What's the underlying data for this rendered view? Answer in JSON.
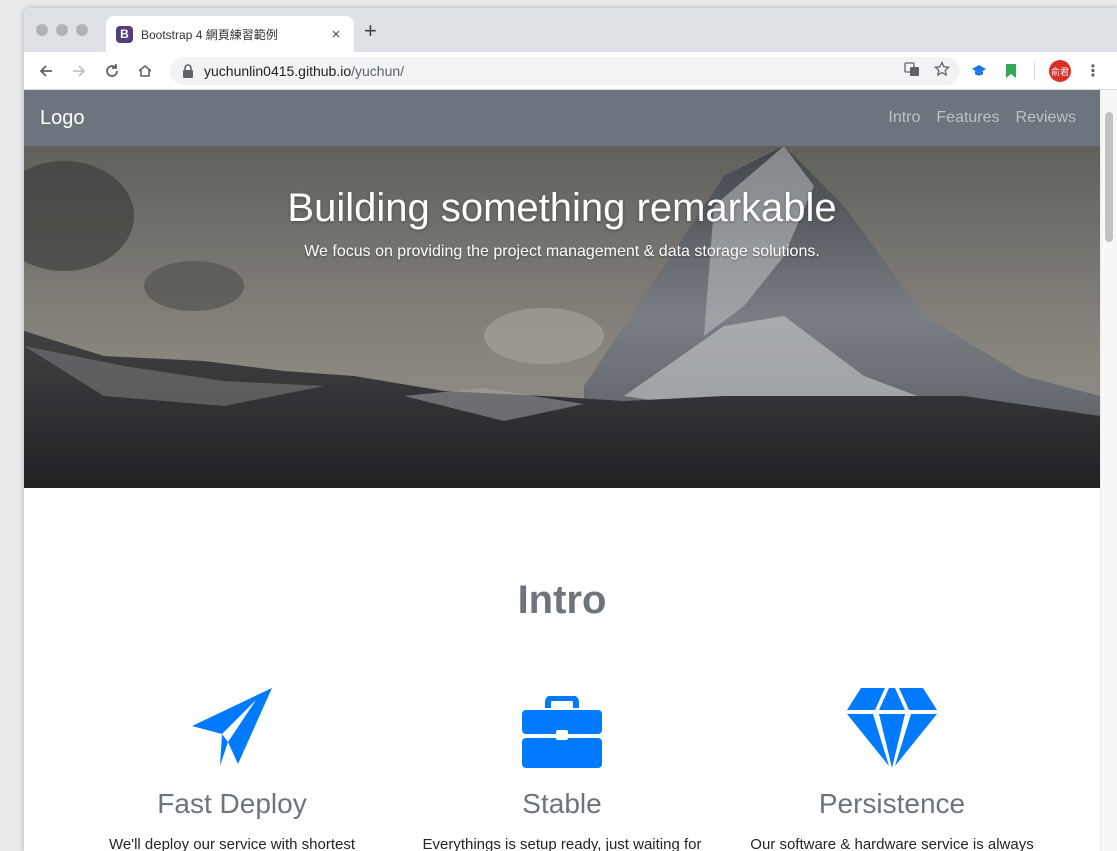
{
  "browser": {
    "tab_title": "Bootstrap 4 網頁練習範例",
    "tab_favicon_letter": "B",
    "tab_close": "×",
    "new_tab": "+",
    "url_host": "yuchunlin0415.github.io",
    "url_path": "/yuchun/",
    "avatar_text": "俞君"
  },
  "navbar": {
    "brand": "Logo",
    "links": [
      "Intro",
      "Features",
      "Reviews"
    ]
  },
  "hero": {
    "title": "Building something remarkable",
    "subtitle": "We focus on providing the project management & data storage solutions."
  },
  "intro": {
    "title": "Intro",
    "features": [
      {
        "icon": "paper-plane-icon",
        "title": "Fast Deploy",
        "text": "We'll deploy our service with shortest"
      },
      {
        "icon": "briefcase-icon",
        "title": "Stable",
        "text": "Everythings is setup ready, just waiting for"
      },
      {
        "icon": "gem-icon",
        "title": "Persistence",
        "text": "Our software & hardware service is always"
      }
    ]
  },
  "colors": {
    "navbar_bg": "#6c757d",
    "icon_blue": "#007bff",
    "heading_gray": "#6c757d"
  }
}
